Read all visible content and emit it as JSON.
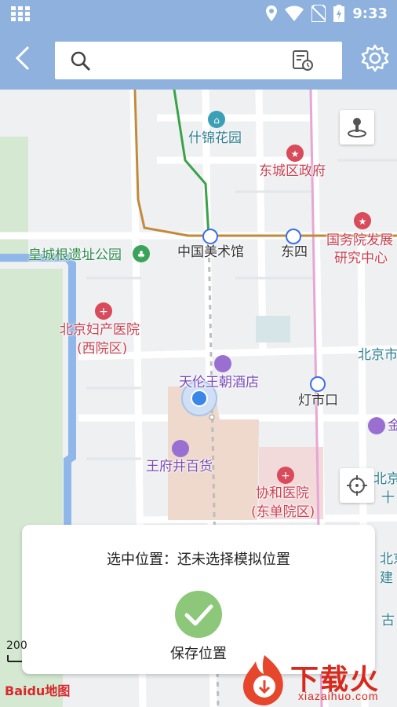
{
  "status_bar": {
    "time": "9:33",
    "icons": [
      "grid-icon",
      "location-icon",
      "wifi-icon",
      "no-sim-icon",
      "battery-charging-icon"
    ]
  },
  "toolbar": {
    "search_placeholder": "",
    "icons": [
      "back-arrow-icon",
      "search-icon",
      "history-icon",
      "gear-icon"
    ]
  },
  "map": {
    "labels": {
      "shijin_garden": "什锦花园",
      "dongcheng_gov": "东城区政府",
      "state_council": "国务院发展",
      "research_center": "研究中心",
      "huangcheng_park": "皇城根遗址公园",
      "art_museum": "中国美术馆",
      "dongsi": "东四",
      "beijing_maternity": "北京妇产医院",
      "xiyuan": "(西院区)",
      "beijing_city": "北京市",
      "tianlun_hotel": "天伦王朝酒店",
      "dengshikou": "灯市口",
      "jin": "金",
      "wangfujing": "王府井百货",
      "xiehe": "协和医院",
      "dongdan": "(东单院区)",
      "beijing_right": "北京",
      "shi": "十",
      "bei_right": "北京",
      "jian": "建",
      "gu": "古"
    },
    "buttons": {
      "street_view": "street-view-icon",
      "locate": "crosshair-icon"
    }
  },
  "bottom_card": {
    "selected_text": "选中位置：还未选择模拟位置",
    "save_label": "保存位置",
    "save_icon": "checkmark-icon"
  },
  "scale": "200",
  "baidu_logo": "Baidu地图",
  "watermark": {
    "text": "下载火",
    "url": "xiazaihuo.com"
  },
  "colors": {
    "toolbar": "#8eb2dd",
    "save_green": "#8cc77a",
    "watermark_red": "#d8291c"
  }
}
